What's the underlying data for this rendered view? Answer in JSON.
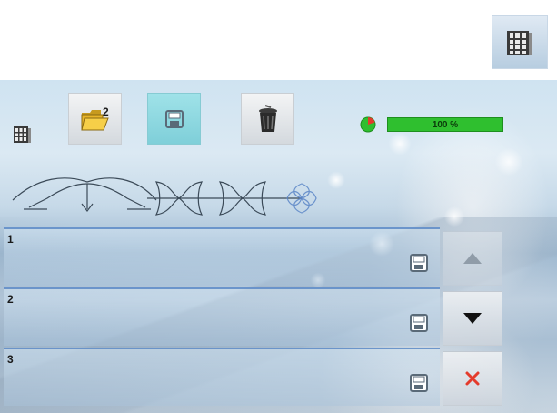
{
  "memory_button": {
    "icon": "memory-icon"
  },
  "toolbar": {
    "memory_icon": "memory-icon",
    "buttons": [
      {
        "name": "open-folder-button",
        "icon": "folder-open-icon",
        "badge": "2",
        "active": false
      },
      {
        "name": "save-button",
        "icon": "save-icon",
        "active": true
      },
      {
        "name": "delete-button",
        "icon": "trash-icon",
        "active": false
      }
    ],
    "memory_usage": {
      "percent": 100,
      "label": "100 %",
      "bar_color": "#2fbf2f",
      "pie_colors": [
        "#2fbf2f",
        "#e43b2c"
      ]
    }
  },
  "pattern_strip": {
    "icons": [
      "stitch-combo-pattern"
    ]
  },
  "rows": [
    {
      "number": "1"
    },
    {
      "number": "2"
    },
    {
      "number": "3"
    }
  ],
  "side_buttons": [
    {
      "name": "scroll-up-button",
      "icon": "arrow-up-icon",
      "enabled": false
    },
    {
      "name": "scroll-down-button",
      "icon": "arrow-down-icon",
      "enabled": true
    },
    {
      "name": "close-button",
      "icon": "close-icon",
      "color": "#e43b2c",
      "enabled": true
    }
  ]
}
